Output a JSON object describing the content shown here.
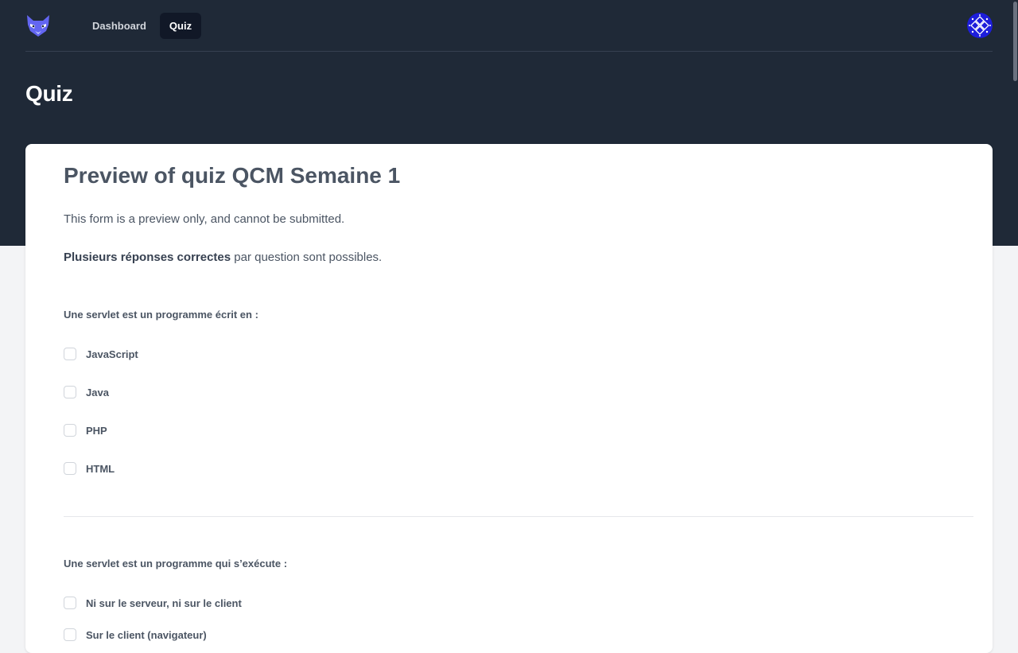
{
  "nav": {
    "logo_icon": "fox-logo-icon",
    "links": [
      {
        "label": "Dashboard",
        "active": false
      },
      {
        "label": "Quiz",
        "active": true
      }
    ],
    "avatar_icon": "user-avatar-icon"
  },
  "page": {
    "title": "Quiz"
  },
  "quiz": {
    "heading": "Preview of quiz QCM Semaine 1",
    "notice": "This form is a preview only, and cannot be submitted.",
    "hint_bold": "Plusieurs réponses correctes",
    "hint_rest": " par question sont possibles.",
    "questions": [
      {
        "label": "Une servlet est un programme écrit en :",
        "options": [
          "JavaScript",
          "Java",
          "PHP",
          "HTML"
        ]
      },
      {
        "label": "Une servlet est un programme qui s’exécute :",
        "options": [
          "Ni sur le serveur, ni sur le client",
          "Sur le client (navigateur)"
        ]
      }
    ]
  },
  "colors": {
    "header_bg": "#1f2937",
    "page_bg": "#f3f4f6",
    "accent": "#6366f1"
  }
}
